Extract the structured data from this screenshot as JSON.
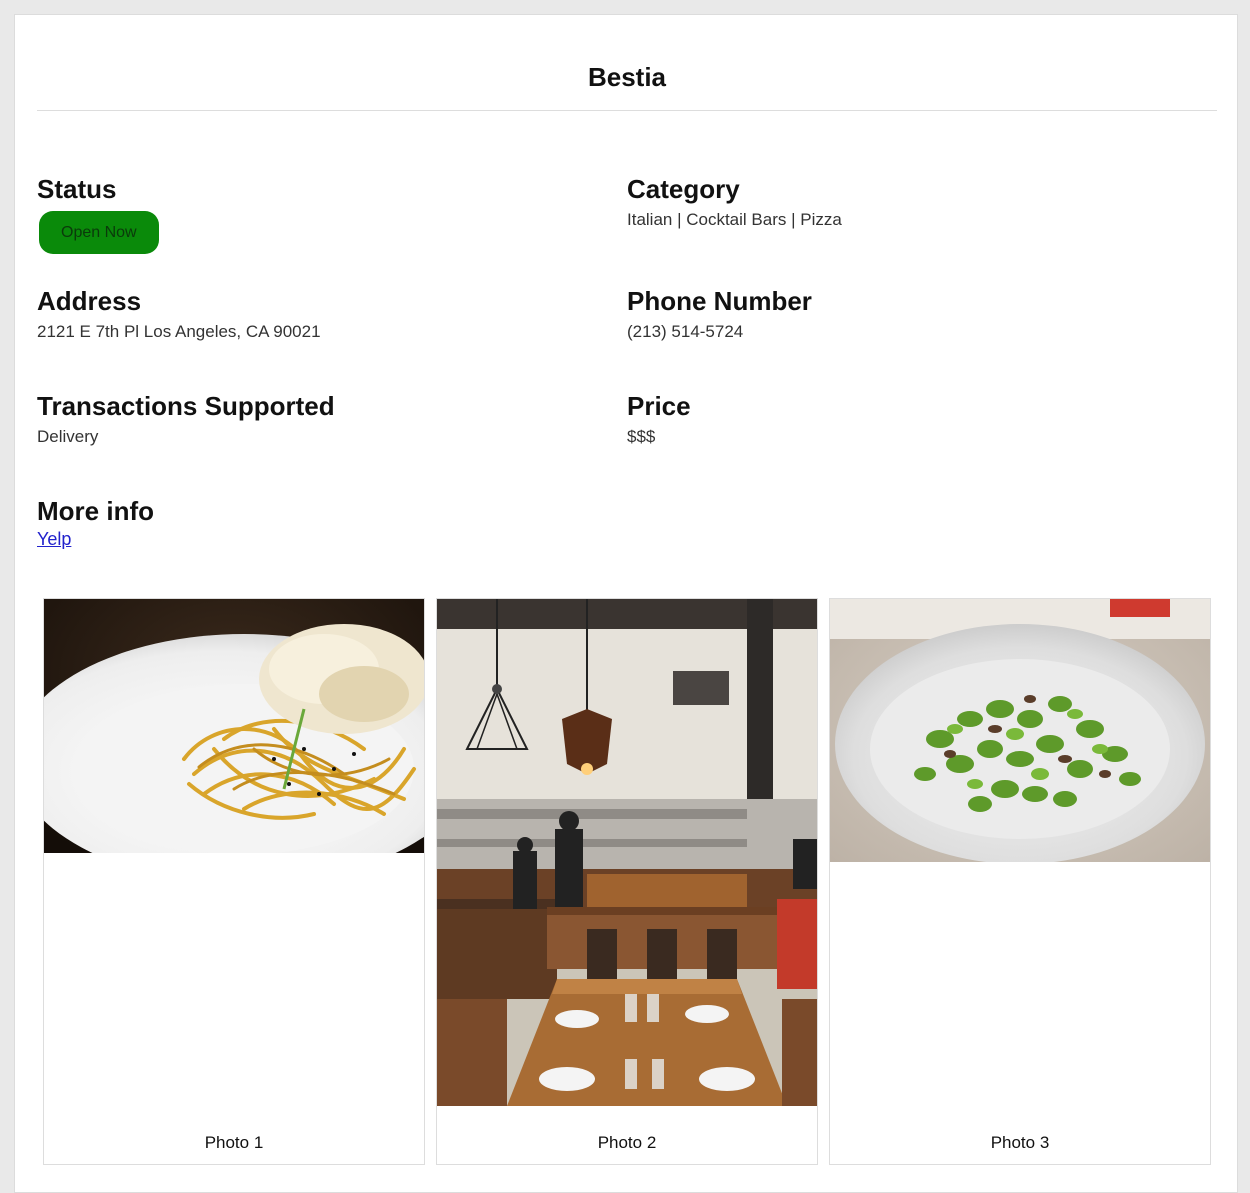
{
  "restaurant": {
    "name": "Bestia"
  },
  "fields": {
    "status": {
      "label": "Status",
      "value": "Open Now",
      "color": "#0a8a0a"
    },
    "category": {
      "label": "Category",
      "value": "Italian | Cocktail Bars | Pizza"
    },
    "address": {
      "label": "Address",
      "value": "2121 E 7th Pl Los Angeles, CA 90021"
    },
    "phone": {
      "label": "Phone Number",
      "value": "(213) 514-5724"
    },
    "transactions": {
      "label": "Transactions Supported",
      "value": "Delivery"
    },
    "price": {
      "label": "Price",
      "value": "$$$"
    },
    "more_info": {
      "label": "More info",
      "link_text": "Yelp"
    }
  },
  "photos": [
    {
      "caption": "Photo 1",
      "subject": "pasta-dish"
    },
    {
      "caption": "Photo 2",
      "subject": "restaurant-interior"
    },
    {
      "caption": "Photo 3",
      "subject": "green-vegetable-dish"
    }
  ]
}
